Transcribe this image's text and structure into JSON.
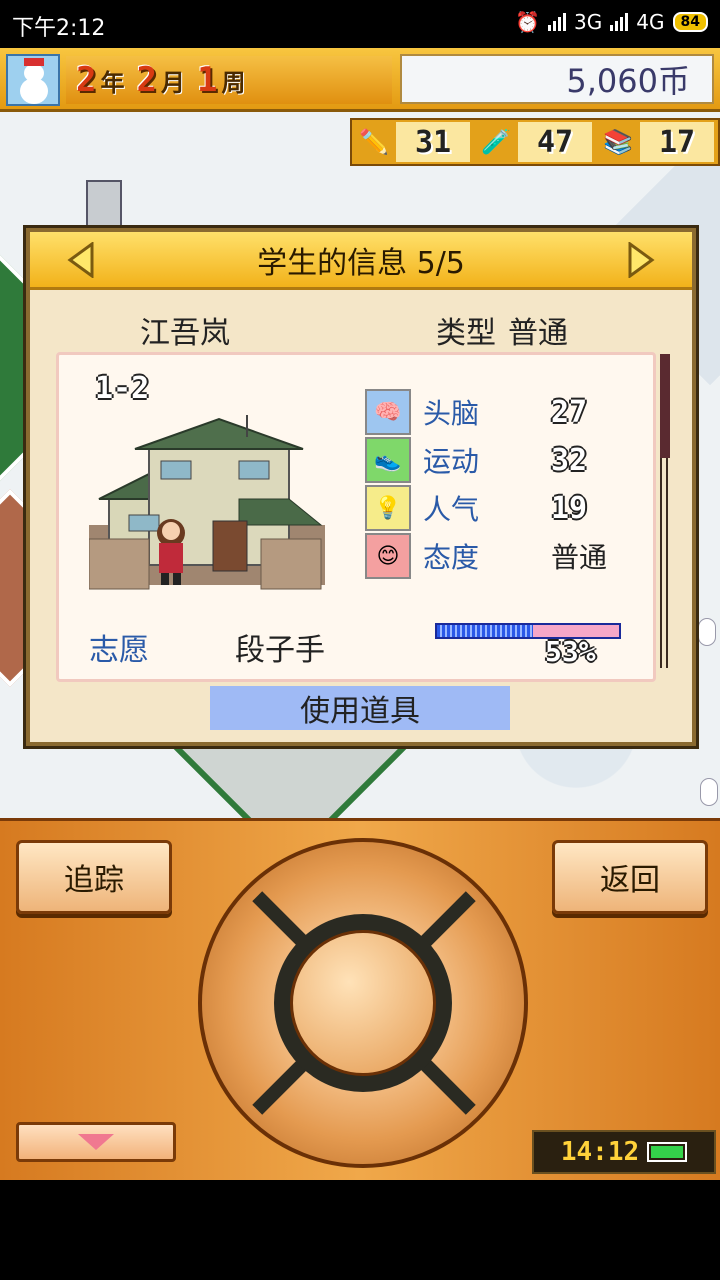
{
  "status_bar": {
    "time": "下午2:12",
    "network_a": "3G",
    "network_b": "4G",
    "battery": "84"
  },
  "hud": {
    "year": "2",
    "year_unit": "年",
    "month": "2",
    "month_unit": "月",
    "week": "1",
    "week_unit": "周",
    "money": "5,060币",
    "resources": [
      {
        "icon": "pencil-icon",
        "value": "31"
      },
      {
        "icon": "flask-icon",
        "value": "47"
      },
      {
        "icon": "book-stack-icon",
        "value": "17"
      }
    ]
  },
  "dialog": {
    "title": "学生的信息 5/5",
    "student_name": "江吾岚",
    "type_label": "类型",
    "type_value": "普通",
    "class": "1-2",
    "stats": [
      {
        "label": "头脑",
        "value": "27",
        "icon": "brain-icon"
      },
      {
        "label": "运动",
        "value": "32",
        "icon": "sneaker-icon"
      },
      {
        "label": "人气",
        "value": "19",
        "icon": "lightbulb-icon"
      },
      {
        "label": "态度",
        "value": "普通",
        "icon": "smiley-icon"
      }
    ],
    "aspiration_label": "志愿",
    "aspiration_value": "段子手",
    "progress_percent": 53,
    "progress_text": "53%",
    "use_item_button": "使用道具"
  },
  "controls": {
    "track_button": "追踪",
    "back_button": "返回",
    "clock": "14:12"
  },
  "colors": {
    "accent_orange": "#e39a12",
    "label_blue": "#2a5aa8",
    "use_button_bg": "#9fbaf5"
  }
}
